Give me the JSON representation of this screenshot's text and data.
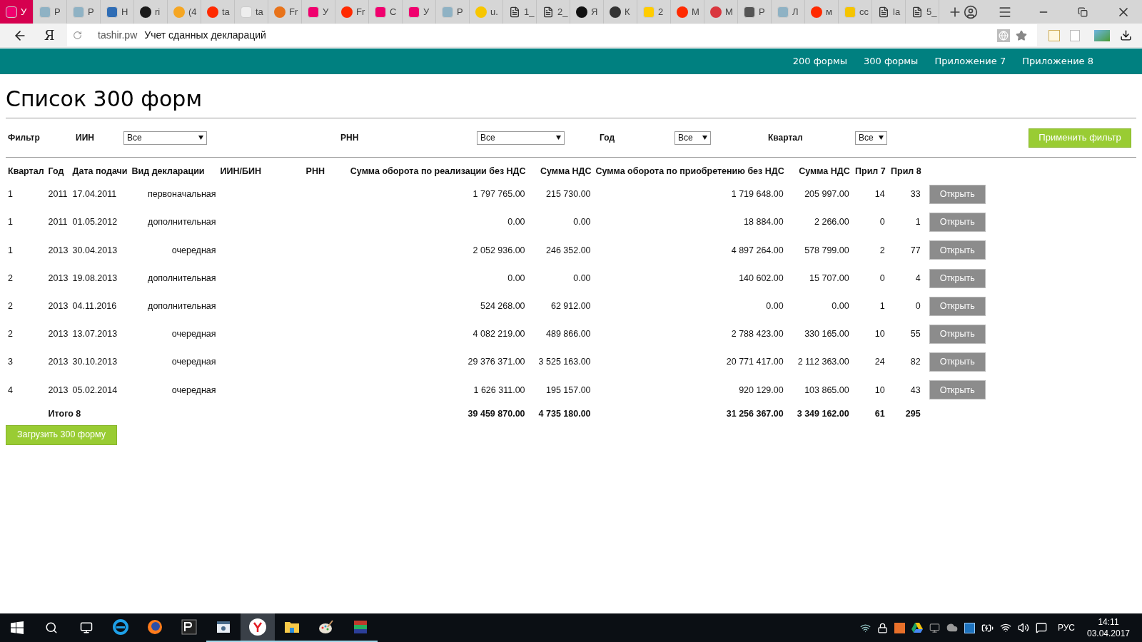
{
  "browser": {
    "tabs": [
      {
        "label": "У",
        "selected": true,
        "kind": "tile",
        "color": "#f0006e"
      },
      {
        "label": "Р",
        "selected": false,
        "kind": "tile",
        "color": "#8fb2c4"
      },
      {
        "label": "Р",
        "selected": false,
        "kind": "tile",
        "color": "#8fb2c4"
      },
      {
        "label": "Н",
        "selected": false,
        "kind": "tile",
        "color": "#2f6db5"
      },
      {
        "label": "ri",
        "selected": false,
        "kind": "round",
        "color": "#1b1b1b"
      },
      {
        "label": "(4",
        "selected": false,
        "kind": "round",
        "color": "#f5a623"
      },
      {
        "label": "ta",
        "selected": false,
        "kind": "round",
        "color": "#ff2a00"
      },
      {
        "label": "ta",
        "selected": false,
        "kind": "tile",
        "color": "#eeeeee"
      },
      {
        "label": "Fr",
        "selected": false,
        "kind": "round",
        "color": "#e8731a"
      },
      {
        "label": "У",
        "selected": false,
        "kind": "tile",
        "color": "#f0006e"
      },
      {
        "label": "Fr",
        "selected": false,
        "kind": "round",
        "color": "#ff2a00"
      },
      {
        "label": "С",
        "selected": false,
        "kind": "tile",
        "color": "#f0006e"
      },
      {
        "label": "У",
        "selected": false,
        "kind": "tile",
        "color": "#f0006e"
      },
      {
        "label": "Р",
        "selected": false,
        "kind": "tile",
        "color": "#8fb2c4"
      },
      {
        "label": "u.",
        "selected": false,
        "kind": "round",
        "color": "#f7c600"
      },
      {
        "label": "1_",
        "selected": false,
        "kind": "doc",
        "color": "#333333"
      },
      {
        "label": "2_",
        "selected": false,
        "kind": "doc",
        "color": "#333333"
      },
      {
        "label": "Я",
        "selected": false,
        "kind": "round",
        "color": "#111111"
      },
      {
        "label": "К",
        "selected": false,
        "kind": "round",
        "color": "#333333"
      },
      {
        "label": "2",
        "selected": false,
        "kind": "tile",
        "color": "#ffcc00"
      },
      {
        "label": "М",
        "selected": false,
        "kind": "round",
        "color": "#ff2a00"
      },
      {
        "label": "М",
        "selected": false,
        "kind": "round",
        "color": "#d9363e"
      },
      {
        "label": "Р",
        "selected": false,
        "kind": "tile",
        "color": "#555555"
      },
      {
        "label": "Л",
        "selected": false,
        "kind": "tile",
        "color": "#8fb2c4"
      },
      {
        "label": "м",
        "selected": false,
        "kind": "round",
        "color": "#ff2a00"
      },
      {
        "label": "cc",
        "selected": false,
        "kind": "tile",
        "color": "#f5c400"
      },
      {
        "label": "la",
        "selected": false,
        "kind": "doc",
        "color": "#333333"
      },
      {
        "label": "5_",
        "selected": false,
        "kind": "doc",
        "color": "#333333"
      }
    ],
    "home": "Я",
    "domain": "tashir.pw",
    "page_title": "Учет сданных деклараций"
  },
  "nav": [
    {
      "label": "200 формы"
    },
    {
      "label": "300 формы"
    },
    {
      "label": "Приложение 7"
    },
    {
      "label": "Приложение 8"
    }
  ],
  "page": {
    "title": "Список 300 форм"
  },
  "filter": {
    "label": "Фильтр",
    "fields": [
      {
        "label": "ИИН",
        "value": "Все"
      },
      {
        "label": "РНН",
        "value": "Все"
      },
      {
        "label": "Год",
        "value": "Все"
      },
      {
        "label": "Квартал",
        "value": "Все"
      }
    ],
    "apply": "Применить фильтр"
  },
  "table": {
    "columns": [
      "Квартал",
      "Год",
      "Дата подачи",
      "Вид декларации",
      "ИИН/БИН",
      "РНН",
      "Сумма оборота по реализации без НДС",
      "Сумма НДС",
      "Сумма оборота по приобретению без НДС",
      "Сумма НДС",
      "Прил 7",
      "Прил 8"
    ],
    "rows": [
      {
        "quarter": "1",
        "year": "2011",
        "date": "17.04.2011",
        "type": "первоначальная",
        "sales": "1 797 765.00",
        "sales_vat": "215 730.00",
        "purchases": "1 719 648.00",
        "purchases_vat": "205 997.00",
        "app7": "14",
        "app8": "33",
        "action": "Открыть"
      },
      {
        "quarter": "1",
        "year": "2011",
        "date": "01.05.2012",
        "type": "дополнительная",
        "sales": "0.00",
        "sales_vat": "0.00",
        "purchases": "18 884.00",
        "purchases_vat": "2 266.00",
        "app7": "0",
        "app8": "1",
        "action": "Открыть"
      },
      {
        "quarter": "1",
        "year": "2013",
        "date": "30.04.2013",
        "type": "очередная",
        "sales": "2 052 936.00",
        "sales_vat": "246 352.00",
        "purchases": "4 897 264.00",
        "purchases_vat": "578 799.00",
        "app7": "2",
        "app8": "77",
        "action": "Открыть"
      },
      {
        "quarter": "2",
        "year": "2013",
        "date": "19.08.2013",
        "type": "дополнительная",
        "sales": "0.00",
        "sales_vat": "0.00",
        "purchases": "140 602.00",
        "purchases_vat": "15 707.00",
        "app7": "0",
        "app8": "4",
        "action": "Открыть"
      },
      {
        "quarter": "2",
        "year": "2013",
        "date": "04.11.2016",
        "type": "дополнительная",
        "sales": "524 268.00",
        "sales_vat": "62 912.00",
        "purchases": "0.00",
        "purchases_vat": "0.00",
        "app7": "1",
        "app8": "0",
        "action": "Открыть"
      },
      {
        "quarter": "2",
        "year": "2013",
        "date": "13.07.2013",
        "type": "очередная",
        "sales": "4 082 219.00",
        "sales_vat": "489 866.00",
        "purchases": "2 788 423.00",
        "purchases_vat": "330 165.00",
        "app7": "10",
        "app8": "55",
        "action": "Открыть"
      },
      {
        "quarter": "3",
        "year": "2013",
        "date": "30.10.2013",
        "type": "очередная",
        "sales": "29 376 371.00",
        "sales_vat": "3 525 163.00",
        "purchases": "20 771 417.00",
        "purchases_vat": "2 112 363.00",
        "app7": "24",
        "app8": "82",
        "action": "Открыть"
      },
      {
        "quarter": "4",
        "year": "2013",
        "date": "05.02.2014",
        "type": "очередная",
        "sales": "1 626 311.00",
        "sales_vat": "195 157.00",
        "purchases": "920 129.00",
        "purchases_vat": "103 865.00",
        "app7": "10",
        "app8": "43",
        "action": "Открыть"
      }
    ],
    "total": {
      "label": "Итого 8",
      "sales": "39 459 870.00",
      "sales_vat": "4 735 180.00",
      "purchases": "31 256 367.00",
      "purchases_vat": "3 349 162.00",
      "app7": "61",
      "app8": "295"
    }
  },
  "upload_button": "Загрузить 300 форму",
  "taskbar": {
    "apps": [
      {
        "kind": "ie",
        "running": false,
        "selected": false
      },
      {
        "kind": "firefox",
        "running": false,
        "selected": false
      },
      {
        "kind": "pw",
        "running": false,
        "selected": false
      },
      {
        "kind": "doc",
        "running": true,
        "selected": false
      },
      {
        "kind": "yandex",
        "running": true,
        "selected": true
      },
      {
        "kind": "folder",
        "running": true,
        "selected": false
      },
      {
        "kind": "paint",
        "running": true,
        "selected": false
      },
      {
        "kind": "archive",
        "running": true,
        "selected": false
      }
    ],
    "language": "РУС",
    "time": "14:11",
    "date": "03.04.2017"
  }
}
